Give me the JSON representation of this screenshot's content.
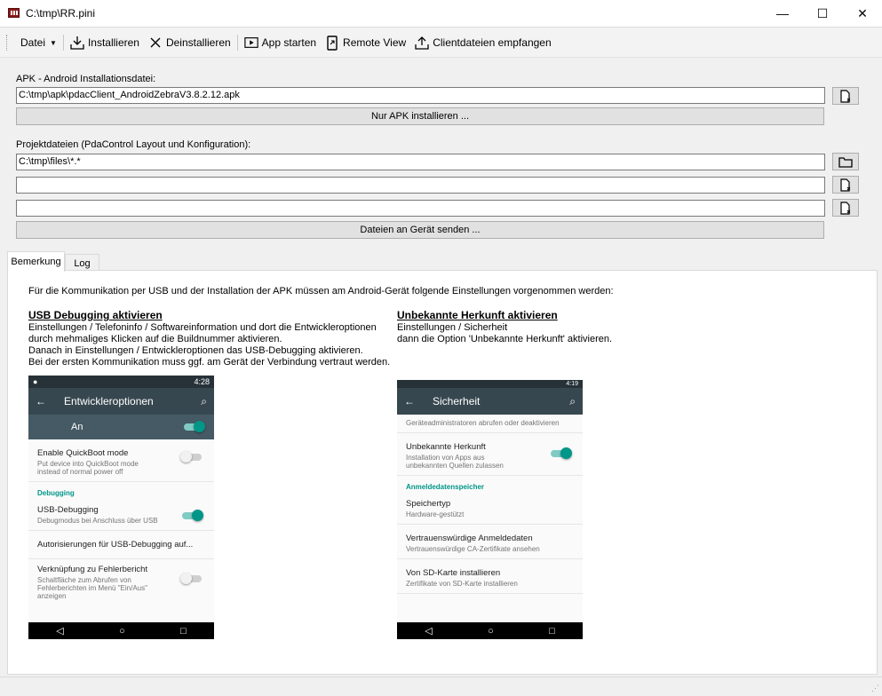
{
  "window": {
    "title": "C:\\tmp\\RR.pini",
    "minimize": "—",
    "maximize": "☐",
    "close": "✕"
  },
  "toolbar": {
    "datei": "Datei",
    "installieren": "Installieren",
    "deinstallieren": "Deinstallieren",
    "app_starten": "App starten",
    "remote_view": "Remote View",
    "clientdateien": "Clientdateien empfangen"
  },
  "apk": {
    "label": "APK - Android Installationsdatei:",
    "path": "C:\\tmp\\apk\\pdacClient_AndroidZebraV3.8.2.12.apk",
    "install_button": "Nur APK installieren ..."
  },
  "projekt": {
    "label": "Projektdateien (PdaControl Layout und Konfiguration):",
    "path1": "C:\\tmp\\files\\*.*",
    "path2": "",
    "path3": "",
    "send_button": "Dateien an Gerät senden ..."
  },
  "tabs": {
    "bemerkung": "Bemerkung",
    "log": "Log"
  },
  "notes": {
    "intro": "Für die Kommunikation per USB und der Installation der APK müssen am Android-Gerät folgende Einstellungen vorgenommen werden:",
    "usb_title": "USB Debugging aktivieren",
    "usb_text": "Einstellungen / Telefoninfo / Softwareinformation und dort die Entwickleroptionen\ndurch mehmaliges Klicken auf die Buildnummer aktivieren.\nDanach in Einstellungen / Entwickleroptionen das USB-Debugging aktivieren.\nBei der ersten Kommunikation muss ggf. am Gerät der Verbindung vertraut werden.",
    "unknown_title": "Unbekannte Herkunft aktivieren",
    "unknown_text": "Einstellungen / Sicherheit\ndann die Option 'Unbekannte Herkunft' aktivieren."
  },
  "phone1": {
    "time": "4:28",
    "title": "Entwickleroptionen",
    "master": "An",
    "quickboot_title": "Enable QuickBoot mode",
    "quickboot_desc": "Put device into QuickBoot mode instead of normal power off",
    "category": "Debugging",
    "usb_title": "USB-Debugging",
    "usb_desc": "Debugmodus bei Anschluss über USB",
    "auth": "Autorisierungen für USB-Debugging auf...",
    "bug_title": "Verknüpfung zu Fehlerbericht",
    "bug_desc": "Schaltfläche zum Abrufen von Fehlerberichten im Menü \"Ein/Aus\" anzeigen"
  },
  "phone2": {
    "time": "4:19",
    "title": "Sicherheit",
    "top_desc": "Geräteadministratoren abrufen oder deaktivieren",
    "unknown_title": "Unbekannte Herkunft",
    "unknown_desc": "Installation von Apps aus unbekannten Quellen zulassen",
    "category": "Anmeldedatenspeicher",
    "storage_title": "Speichertyp",
    "storage_desc": "Hardware-gestützt",
    "trusted_title": "Vertrauenswürdige Anmeldedaten",
    "trusted_desc": "Vertrauenswürdige CA-Zertifikate ansehen",
    "sd_title": "Von SD-Karte installieren",
    "sd_desc": "Zertifikate von SD-Karte installieren"
  }
}
